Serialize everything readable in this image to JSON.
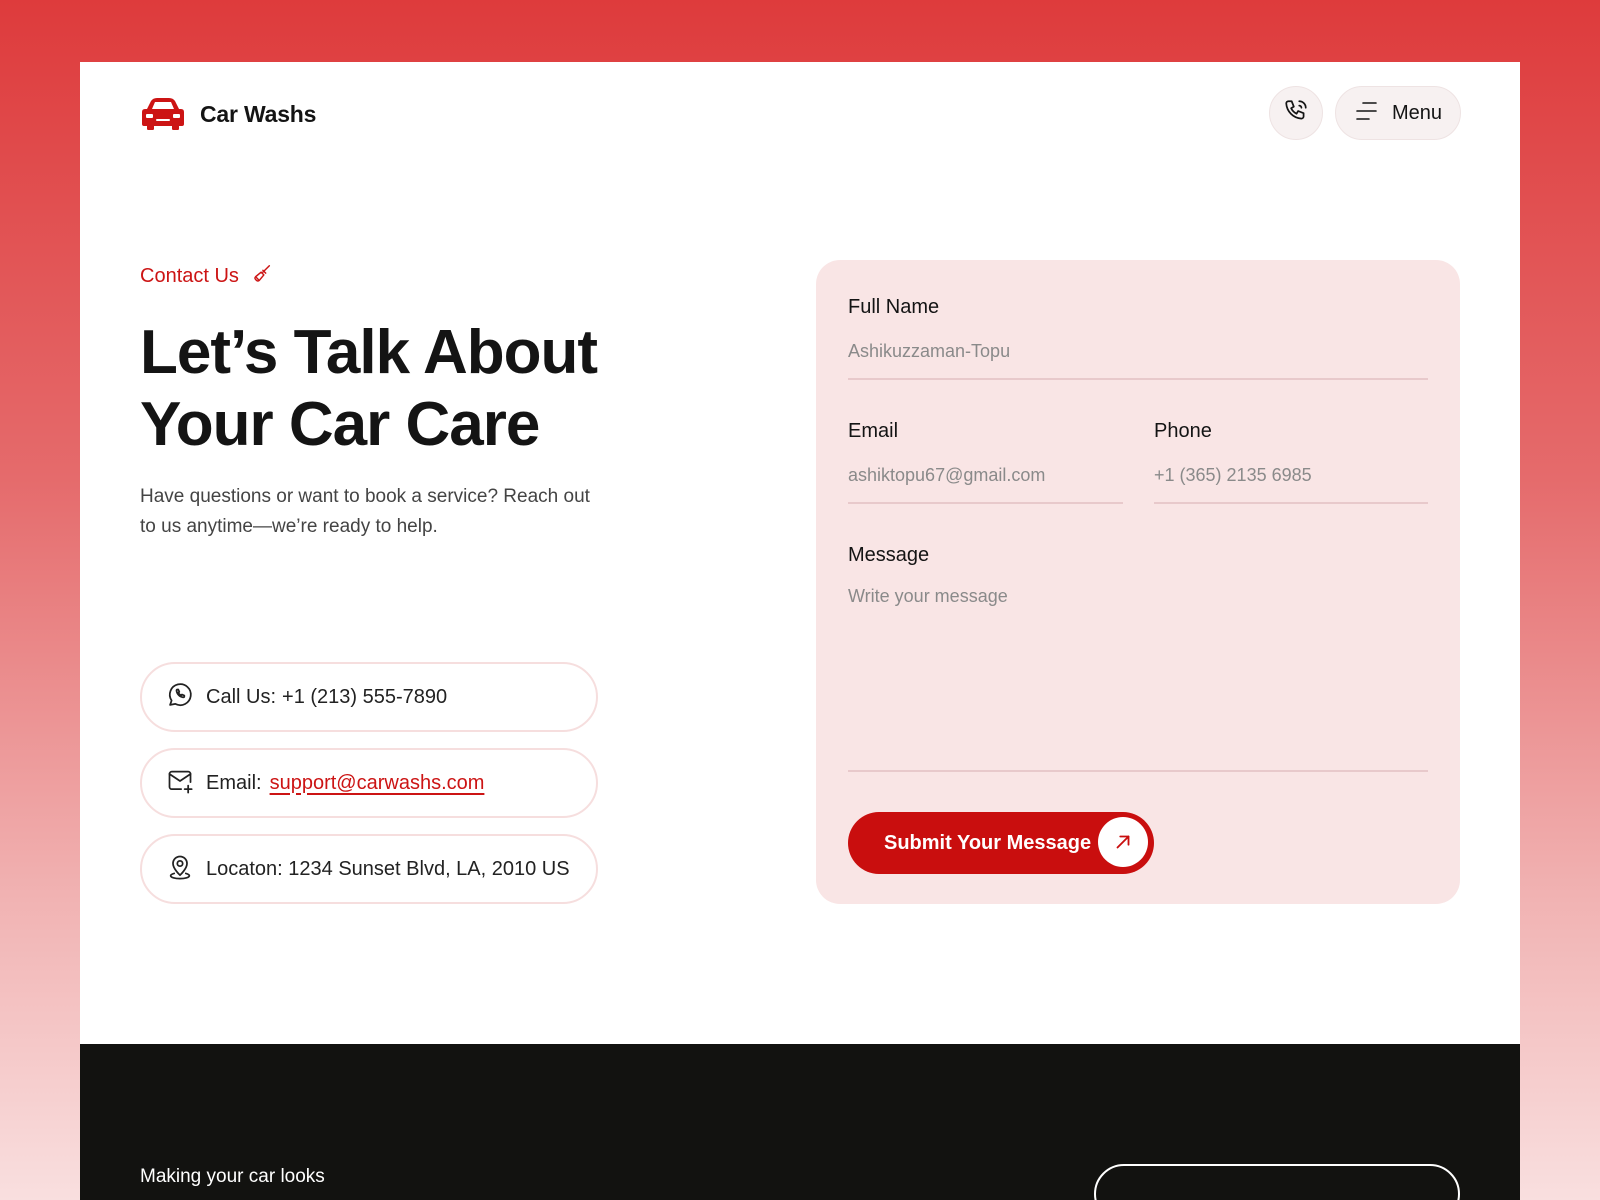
{
  "header": {
    "brand_name": "Car Washs",
    "menu_label": "Menu"
  },
  "hero": {
    "eyebrow": "Contact Us",
    "headline": "Let’s Talk About Your Car Care",
    "subtext": "Have questions or want to book a service? Reach out to us anytime—we’re ready to help."
  },
  "contact": {
    "call_label": "Call Us:",
    "call_value": "+1 (213) 555-7890",
    "email_label": "Email:",
    "email_value": "support@carwashs.com",
    "location_text": "Locaton: 1234 Sunset Blvd, LA, 2010 US"
  },
  "form": {
    "full_name_label": "Full Name",
    "full_name_placeholder": "Ashikuzzaman-Topu",
    "email_label": "Email",
    "email_placeholder": "ashiktopu67@gmail.com",
    "phone_label": "Phone",
    "phone_placeholder": "+1 (365) 2135 6985",
    "message_label": "Message",
    "message_placeholder": "Write your message",
    "submit_label": "Submit Your Message"
  },
  "footer": {
    "tagline": "Making your car looks"
  },
  "icons": {
    "brand": "car-icon",
    "phone": "phone-icon",
    "menu": "menu-icon",
    "eyebrow": "brush-icon",
    "call": "whatsapp-phone-icon",
    "email": "mail-plus-icon",
    "location": "location-pin-icon",
    "submit": "arrow-up-right-icon"
  },
  "colors": {
    "accent": "#c90e0e",
    "form_bg": "#f9e5e5",
    "footer_bg": "#121210",
    "text": "#141414"
  }
}
